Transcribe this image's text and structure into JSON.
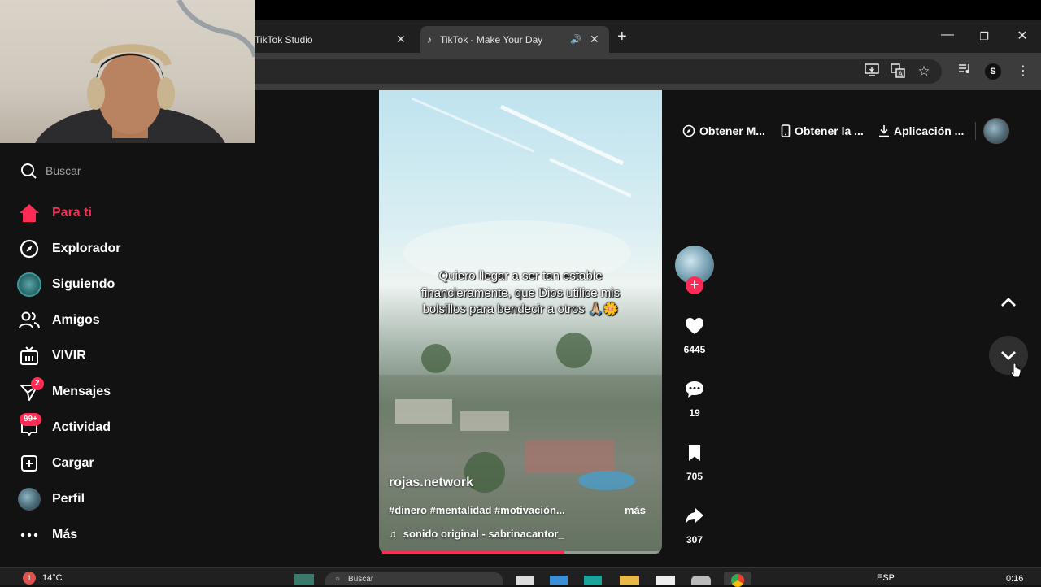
{
  "browser": {
    "tabs": [
      {
        "label": "TikTok Studio"
      },
      {
        "label": "TikTok - Make Your Day"
      }
    ],
    "profile_initial": "S"
  },
  "sidebar": {
    "search_placeholder": "Buscar",
    "items": [
      {
        "label": "Para ti",
        "icon": "home-icon",
        "active": true
      },
      {
        "label": "Explorador",
        "icon": "compass-icon"
      },
      {
        "label": "Siguiendo",
        "icon": "following-avatar-icon"
      },
      {
        "label": "Amigos",
        "icon": "friends-icon"
      },
      {
        "label": "VIVIR",
        "icon": "live-tv-icon"
      },
      {
        "label": "Mensajes",
        "icon": "send-icon",
        "badge": "2"
      },
      {
        "label": "Actividad",
        "icon": "inbox-icon",
        "badge": "99+"
      },
      {
        "label": "Cargar",
        "icon": "upload-icon"
      },
      {
        "label": "Perfil",
        "icon": "profile-avatar-icon"
      },
      {
        "label": "Más",
        "icon": "more-icon"
      }
    ]
  },
  "header_links": [
    {
      "label": "Obtener M...",
      "icon": "coin-icon"
    },
    {
      "label": "Obtener la ...",
      "icon": "phone-icon"
    },
    {
      "label": "Aplicación ...",
      "icon": "download-icon"
    }
  ],
  "video": {
    "caption": "Quiero llegar a ser tan estable financieramente, que Dios utilice mis bolsillos para bendecir a otros 🙏🏼🌼",
    "author": "rojas.network",
    "tags": "#dinero #mentalidad #motivación...",
    "more_label": "más",
    "sound": "sonido original - sabrinacantor_",
    "progress": 0.66
  },
  "actions": {
    "likes": "6445",
    "comments": "19",
    "saves": "705",
    "shares": "307"
  },
  "taskbar": {
    "weather": "14°C",
    "search_placeholder": "Buscar",
    "lang": "ESP",
    "time": "0:16"
  },
  "colors": {
    "accent": "#fe2c55",
    "background": "#121212"
  }
}
